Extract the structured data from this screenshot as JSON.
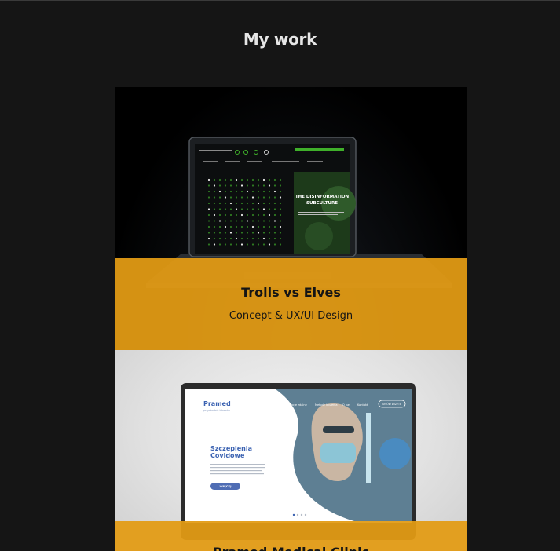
{
  "page": {
    "title": "My work"
  },
  "projects": [
    {
      "title": "Trolls vs Elves",
      "subtitle": "Concept & UX/UI Design",
      "screen": {
        "headline_1": "THE DISINFORMATION",
        "headline_2": "SUBCULTURE"
      }
    },
    {
      "title": "Pramed Medical Clinic",
      "subtitle": "",
      "screen": {
        "logo": "Pramed",
        "logo_sub": "przychodnia lekarska",
        "nav": [
          "Konsultacje zdalne",
          "Metody leczenia",
          "O nas",
          "Kontakt"
        ],
        "nav_button": "UMÓW WIZYTĘ",
        "headline_1": "Szczepienia",
        "headline_2": "Covidowe",
        "cta": "WIĘCEJ"
      }
    }
  ],
  "colors": {
    "background": "#151515",
    "overlay": "#e29b14",
    "title": "#e6e6e6",
    "card_text": "#151515",
    "accent_green": "#3fb02a",
    "accent_blue": "#4f6db4"
  }
}
